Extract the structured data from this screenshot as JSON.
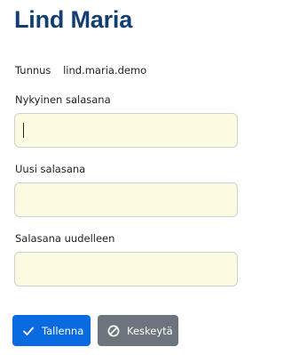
{
  "page": {
    "title": "Lind Maria"
  },
  "account": {
    "label": "Tunnus",
    "value": "lind.maria.demo"
  },
  "fields": {
    "current_password": {
      "label": "Nykyinen salasana",
      "value": ""
    },
    "new_password": {
      "label": "Uusi salasana",
      "value": ""
    },
    "repeat_password": {
      "label": "Salasana uudelleen",
      "value": ""
    }
  },
  "actions": {
    "save_label": "Tallenna",
    "save_icon": "check-icon",
    "cancel_label": "Keskeytä",
    "cancel_icon": "cancel-circle-icon"
  },
  "colors": {
    "title": "#123e73",
    "primary": "#0a6be0",
    "secondary": "#6c757d",
    "input_background": "#fcfbe2",
    "input_border": "#cdd1d5"
  }
}
